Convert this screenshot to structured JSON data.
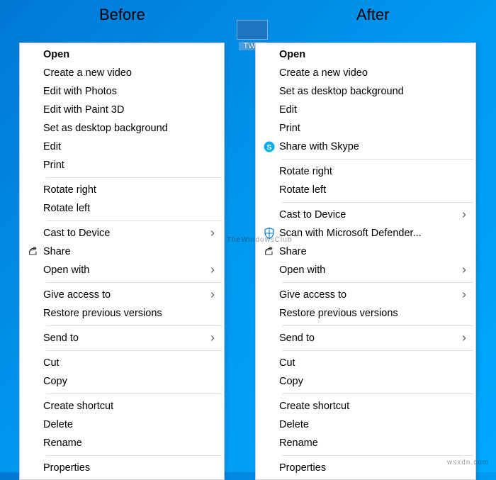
{
  "titles": {
    "before": "Before",
    "after": "After"
  },
  "desktop_icon_label": "TWC",
  "watermark": "wsxdn.com",
  "watermark_mid": "TheWindowsClub",
  "menus": {
    "before": [
      {
        "type": "item",
        "name": "open",
        "label": "Open",
        "bold": true
      },
      {
        "type": "item",
        "name": "create-new-video",
        "label": "Create a new video"
      },
      {
        "type": "item",
        "name": "edit-with-photos",
        "label": "Edit with Photos"
      },
      {
        "type": "item",
        "name": "edit-with-paint3d",
        "label": "Edit with Paint 3D"
      },
      {
        "type": "item",
        "name": "set-desktop-bg",
        "label": "Set as desktop background"
      },
      {
        "type": "item",
        "name": "edit",
        "label": "Edit"
      },
      {
        "type": "item",
        "name": "print",
        "label": "Print"
      },
      {
        "type": "sep"
      },
      {
        "type": "item",
        "name": "rotate-right",
        "label": "Rotate right"
      },
      {
        "type": "item",
        "name": "rotate-left",
        "label": "Rotate left"
      },
      {
        "type": "sep"
      },
      {
        "type": "item",
        "name": "cast-to-device",
        "label": "Cast to Device",
        "submenu": true
      },
      {
        "type": "item",
        "name": "share",
        "label": "Share",
        "icon": "share"
      },
      {
        "type": "item",
        "name": "open-with",
        "label": "Open with",
        "submenu": true
      },
      {
        "type": "sep"
      },
      {
        "type": "item",
        "name": "give-access-to",
        "label": "Give access to",
        "submenu": true
      },
      {
        "type": "item",
        "name": "restore-previous",
        "label": "Restore previous versions"
      },
      {
        "type": "sep"
      },
      {
        "type": "item",
        "name": "send-to",
        "label": "Send to",
        "submenu": true
      },
      {
        "type": "sep"
      },
      {
        "type": "item",
        "name": "cut",
        "label": "Cut"
      },
      {
        "type": "item",
        "name": "copy",
        "label": "Copy"
      },
      {
        "type": "sep"
      },
      {
        "type": "item",
        "name": "create-shortcut",
        "label": "Create shortcut"
      },
      {
        "type": "item",
        "name": "delete",
        "label": "Delete"
      },
      {
        "type": "item",
        "name": "rename",
        "label": "Rename"
      },
      {
        "type": "sep"
      },
      {
        "type": "item",
        "name": "properties",
        "label": "Properties"
      }
    ],
    "after": [
      {
        "type": "item",
        "name": "open",
        "label": "Open",
        "bold": true
      },
      {
        "type": "item",
        "name": "create-new-video",
        "label": "Create a new video"
      },
      {
        "type": "item",
        "name": "set-desktop-bg",
        "label": "Set as desktop background"
      },
      {
        "type": "item",
        "name": "edit",
        "label": "Edit"
      },
      {
        "type": "item",
        "name": "print",
        "label": "Print"
      },
      {
        "type": "item",
        "name": "share-skype",
        "label": "Share with Skype",
        "icon": "skype"
      },
      {
        "type": "sep"
      },
      {
        "type": "item",
        "name": "rotate-right",
        "label": "Rotate right"
      },
      {
        "type": "item",
        "name": "rotate-left",
        "label": "Rotate left"
      },
      {
        "type": "sep"
      },
      {
        "type": "item",
        "name": "cast-to-device",
        "label": "Cast to Device",
        "submenu": true
      },
      {
        "type": "item",
        "name": "scan-defender",
        "label": "Scan with Microsoft Defender...",
        "icon": "defender"
      },
      {
        "type": "item",
        "name": "share",
        "label": "Share",
        "icon": "share"
      },
      {
        "type": "item",
        "name": "open-with",
        "label": "Open with",
        "submenu": true
      },
      {
        "type": "sep"
      },
      {
        "type": "item",
        "name": "give-access-to",
        "label": "Give access to",
        "submenu": true
      },
      {
        "type": "item",
        "name": "restore-previous",
        "label": "Restore previous versions"
      },
      {
        "type": "sep"
      },
      {
        "type": "item",
        "name": "send-to",
        "label": "Send to",
        "submenu": true
      },
      {
        "type": "sep"
      },
      {
        "type": "item",
        "name": "cut",
        "label": "Cut"
      },
      {
        "type": "item",
        "name": "copy",
        "label": "Copy"
      },
      {
        "type": "sep"
      },
      {
        "type": "item",
        "name": "create-shortcut",
        "label": "Create shortcut"
      },
      {
        "type": "item",
        "name": "delete",
        "label": "Delete"
      },
      {
        "type": "item",
        "name": "rename",
        "label": "Rename"
      },
      {
        "type": "sep"
      },
      {
        "type": "item",
        "name": "properties",
        "label": "Properties"
      }
    ]
  }
}
